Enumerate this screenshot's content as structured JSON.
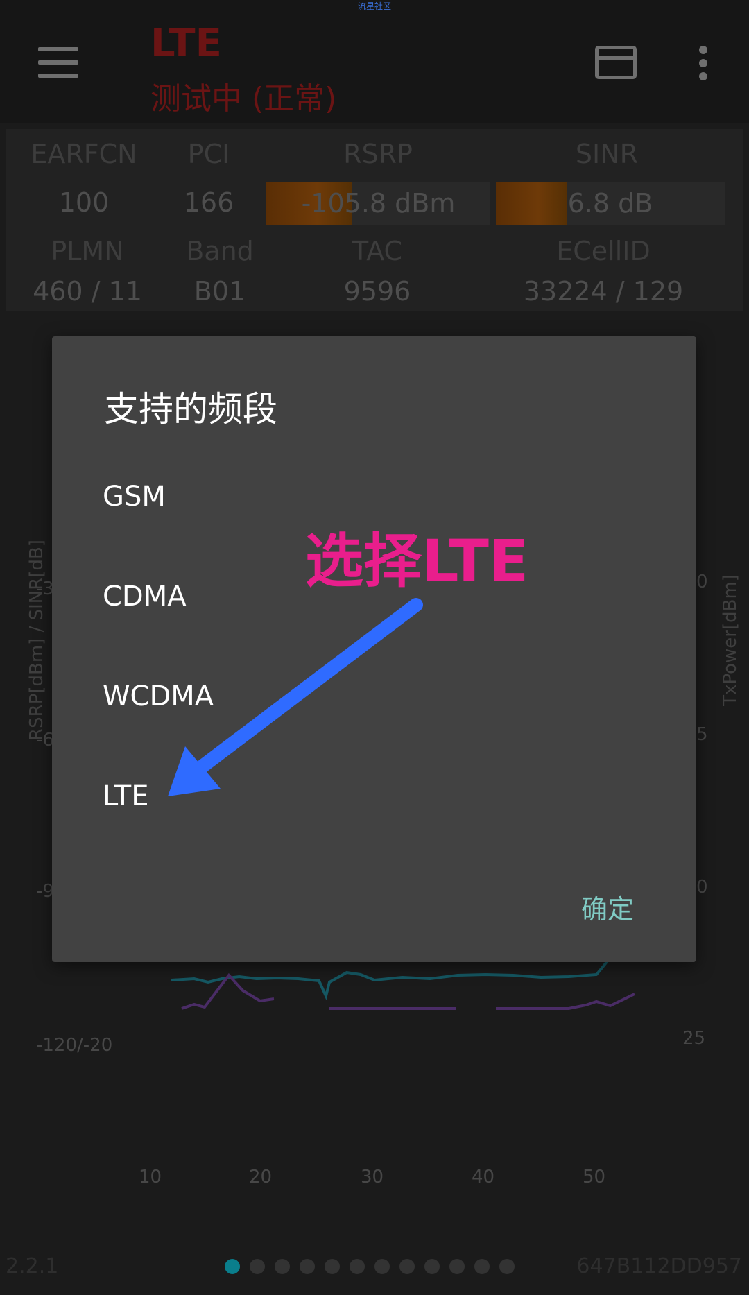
{
  "watermark": "流星社区",
  "appbar": {
    "tech": "LTE",
    "status": "测试中 (正常)",
    "menu_icon": "hamburger-menu-icon",
    "card_icon": "card-icon",
    "more_icon": "more-vert-icon"
  },
  "info": {
    "earfcn": {
      "label": "EARFCN",
      "value": "100"
    },
    "pci": {
      "label": "PCI",
      "value": "166"
    },
    "rsrp": {
      "label": "RSRP",
      "value": "-105.8 dBm",
      "level": 0.38
    },
    "sinr": {
      "label": "SINR",
      "value": "6.8 dB",
      "level": 0.31
    },
    "plmn": {
      "label": "PLMN",
      "value": "460 / 11"
    },
    "band": {
      "label": "Band",
      "value": "B01"
    },
    "tac": {
      "label": "TAC",
      "value": "9596"
    },
    "ecellid": {
      "label": "ECellID",
      "value": "33224 / 129"
    }
  },
  "chart": {
    "left_axis_label": "RSRP[dBm] / SINR[dB]",
    "right_axis_label": "TxPower[dBm]",
    "left_ticks": [
      "-3",
      "-6",
      "-9",
      "-120/-20"
    ],
    "right_ticks": [
      "0",
      "5",
      "0",
      "25"
    ],
    "x_ticks": [
      "10",
      "20",
      "30",
      "40",
      "50"
    ]
  },
  "footer": {
    "version": "2.2.1",
    "device_id": "647B112DD957",
    "page_count": 12,
    "active_page": 0
  },
  "dialog": {
    "title": "支持的频段",
    "options": [
      "GSM",
      "CDMA",
      "WCDMA",
      "LTE"
    ],
    "confirm_label": "确定"
  },
  "annotation": {
    "text": "选择LTE",
    "color": "#e91e8c",
    "arrow_color": "#2f6bff"
  }
}
